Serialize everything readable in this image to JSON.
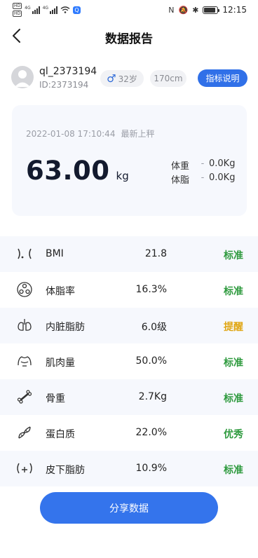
{
  "status_bar": {
    "hd_badges": [
      "HD",
      "HD"
    ],
    "signal_tags": [
      "4G",
      "4G"
    ],
    "app_badge": "Q",
    "time": "12:15",
    "battery_percent": 85
  },
  "nav": {
    "title": "数据报告"
  },
  "profile": {
    "username": "ql_2373194",
    "user_id": "ID:2373194",
    "age": "32岁",
    "height": "170cm",
    "guide_label": "指标说明"
  },
  "weigh": {
    "datetime": "2022-01-08 17:10:44",
    "latest_label": "最新上秤",
    "weight_value": "63.00",
    "weight_unit": "kg",
    "stats": [
      {
        "label": "体重",
        "dash": "-",
        "value": "0.0Kg"
      },
      {
        "label": "体脂",
        "dash": "-",
        "value": "0.0Kg"
      }
    ]
  },
  "metrics": [
    {
      "icon": "bmi-icon",
      "name": "BMI",
      "value": "21.8",
      "status": "标准",
      "status_color": "#2e9a3e"
    },
    {
      "icon": "body-fat-icon",
      "name": "体脂率",
      "value": "16.3%",
      "status": "标准",
      "status_color": "#2e9a3e"
    },
    {
      "icon": "lungs-icon",
      "name": "内脏脂肪",
      "value": "6.0级",
      "status": "提醒",
      "status_color": "#e0a613"
    },
    {
      "icon": "muscle-icon",
      "name": "肌肉量",
      "value": "50.0%",
      "status": "标准",
      "status_color": "#2e9a3e"
    },
    {
      "icon": "bone-icon",
      "name": "骨重",
      "value": "2.7Kg",
      "status": "标准",
      "status_color": "#2e9a3e"
    },
    {
      "icon": "dna-icon",
      "name": "蛋白质",
      "value": "22.0%",
      "status": "优秀",
      "status_color": "#2e9a3e"
    },
    {
      "icon": "subcutaneous-fat-icon",
      "name": "皮下脂肪",
      "value": "10.9%",
      "status": "标准",
      "status_color": "#2e9a3e"
    }
  ],
  "share": {
    "label": "分享数据"
  },
  "colors": {
    "accent": "#3070e8",
    "card_bg": "#f6f8fd",
    "good": "#2e9a3e",
    "warn": "#e0a613"
  }
}
